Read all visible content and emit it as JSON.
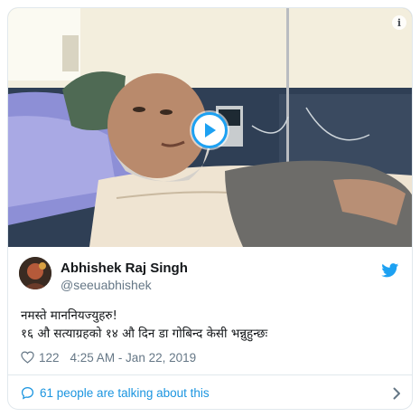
{
  "tweet": {
    "media": {
      "type": "video",
      "play_icon": "play-icon",
      "info_icon": "info-icon",
      "info_glyph": "i"
    },
    "author": {
      "name": "Abhishek Raj Singh",
      "handle": "@seeuabhishek",
      "avatar": "avatar-icon"
    },
    "brand_icon": "twitter-bird-icon",
    "text_lines": [
      "नमस्ते माननियज्युहरु!",
      "१६ औ सत्याग्रहको १४ औ दिन डा गोबिन्द केसी भन्नुहुन्छः"
    ],
    "likes": "122",
    "like_icon": "heart-icon",
    "timestamp": "4:25 AM - Jan 22, 2019",
    "conversation": {
      "label": "61 people are talking about this",
      "icon": "speech-bubble-icon",
      "chevron": "chevron-right-icon"
    }
  },
  "colors": {
    "accent": "#1da1f2",
    "link": "#1b95e0",
    "secondary_text": "#657786",
    "border": "#e1e8ed"
  }
}
